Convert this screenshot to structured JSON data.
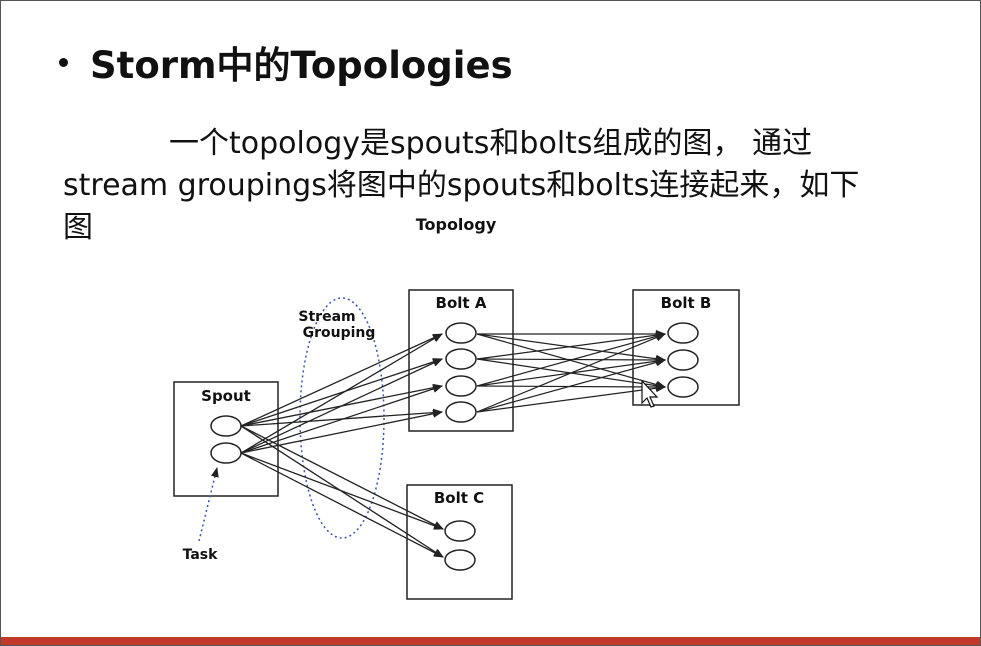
{
  "slide": {
    "title": "Storm中的Topologies",
    "body_lines": [
      "一个topology是spouts和bolts组成的图， 通过",
      "stream groupings将图中的spouts和bolts连接起来，如下",
      "图"
    ]
  },
  "diagram": {
    "title": "Topology",
    "nodes": {
      "spout": {
        "label": "Spout",
        "tasks": 2
      },
      "bolt_a": {
        "label": "Bolt A",
        "tasks": 4
      },
      "bolt_b": {
        "label": "Bolt B",
        "tasks": 3
      },
      "bolt_c": {
        "label": "Bolt C",
        "tasks": 2
      }
    },
    "stream_grouping_label_1": "Stream",
    "stream_grouping_label_2": "Grouping",
    "task_label": "Task"
  },
  "colors": {
    "text": "#111111",
    "line": "#222222",
    "grouping_ellipse": "#3a55a8",
    "bottom_bar": "#c0392b"
  },
  "icons": {
    "cursor": "mouse-pointer-icon"
  }
}
